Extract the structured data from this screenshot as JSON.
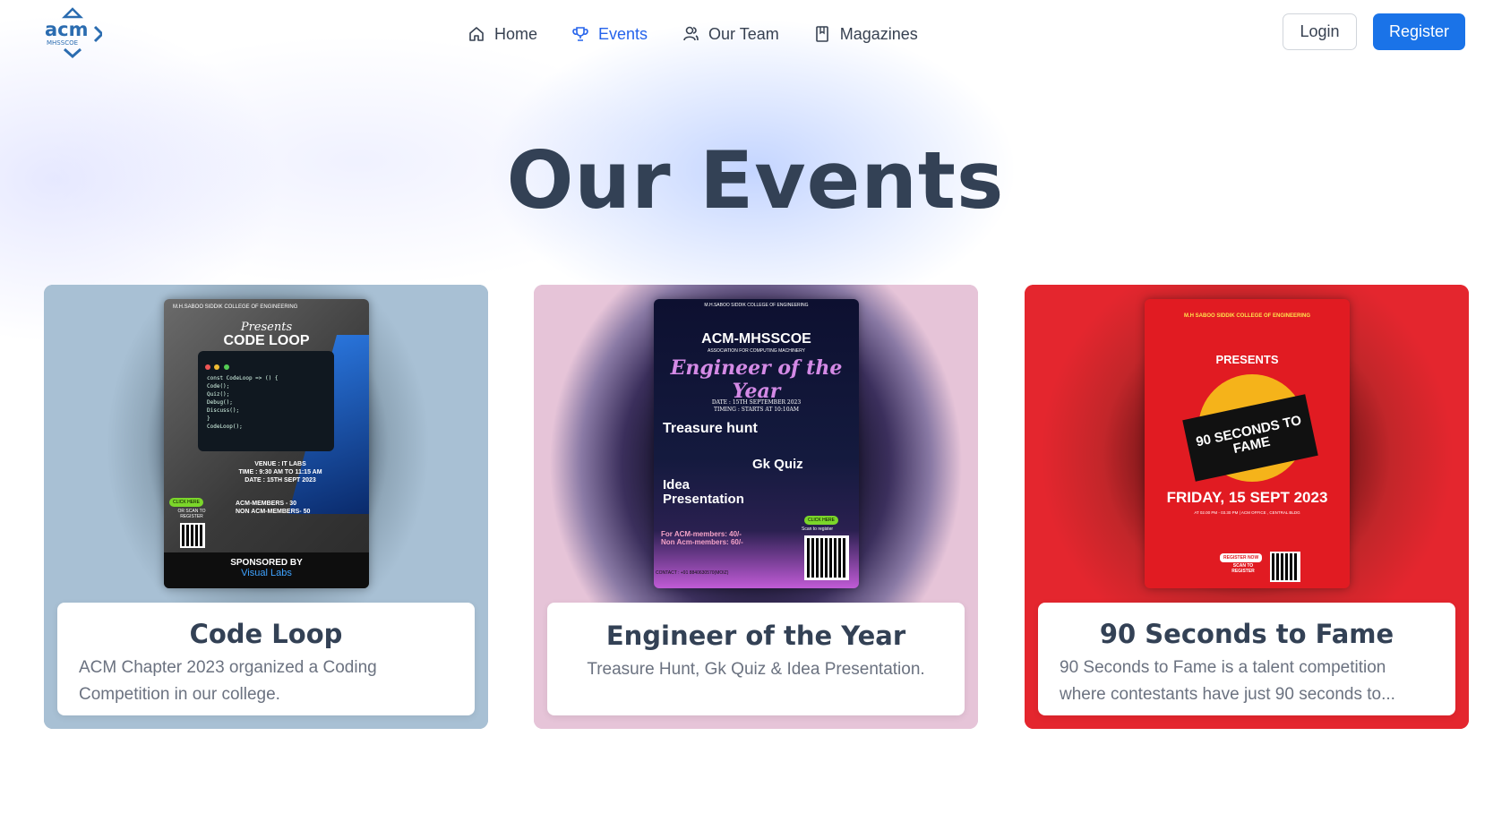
{
  "brand": {
    "logo_text": "acm",
    "logo_sub": "MHSSCOE",
    "accent": "#1a73e8"
  },
  "nav": {
    "items": [
      {
        "label": "Home",
        "icon": "home-icon",
        "active": false
      },
      {
        "label": "Events",
        "icon": "trophy-icon",
        "active": true
      },
      {
        "label": "Our Team",
        "icon": "team-icon",
        "active": false
      },
      {
        "label": "Magazines",
        "icon": "book-icon",
        "active": false
      }
    ],
    "login_label": "Login",
    "register_label": "Register"
  },
  "page": {
    "title": "Our Events"
  },
  "events": [
    {
      "title": "Code Loop",
      "description": "ACM Chapter 2023 organized a Coding Competition in our college.",
      "poster": {
        "college": "M.H.SABOO SIDDIK COLLEGE OF ENGINEERING",
        "presents": "Presents",
        "name": "CODE LOOP",
        "code": [
          "const CodeLoop => () {",
          "Code();",
          "Quiz();",
          "Debug();",
          "Discuss();",
          "}",
          "CodeLoop();"
        ],
        "venue": "VENUE : IT LABS",
        "time": "TIME : 9:30 AM TO 11:15 AM",
        "date": "DATE : 15TH SEPT 2023",
        "fee_members": "ACM-MEMBERS - 30",
        "fee_non": "NON ACM-MEMBERS- 50",
        "click": "CLICK HERE",
        "scan": "OR SCAN TO REGISTER",
        "sponsored": "SPONSORED BY",
        "sponsor": "Visual Labs"
      }
    },
    {
      "title": "Engineer of the Year",
      "description": "Treasure Hunt, Gk Quiz & Idea Presentation.",
      "poster": {
        "college": "M.H.SABOO SIDDIK COLLEGE OF ENGINEERING",
        "org": "ACM-MHSSCOE",
        "org_sub": "ASSOCIATION FOR COMPUTING MACHINERY",
        "name": "Engineer of the Year",
        "date": "DATE : 15TH SEPTEMBER 2023",
        "timing": "TIMING : STARTS AT 10:10AM",
        "item1": "Treasure hunt",
        "item2": "Gk Quiz",
        "item3": "Idea Presentation",
        "fee1": "For ACM-members: 40/-",
        "fee2": "Non Acm-members: 60/-",
        "click": "CLICK HERE",
        "scan": "Scan to register",
        "contact": "CONTACT : +91 8840630570(MOIZ)"
      }
    },
    {
      "title": "90 Seconds to Fame",
      "description": "90 Seconds to Fame is a talent competition where contestants have just 90 seconds to...",
      "poster": {
        "college": "M.H SABOO SIDDIK COLLEGE OF ENGINEERING",
        "presents": "PRESENTS",
        "name": "90 SECONDS TO FAME",
        "date": "FRIDAY, 15 SEPT 2023",
        "time": "AT 02.00 PM - 03.30 PM | ACM OFFICE , CENTRAL BLDG",
        "register": "REGISTER NOW",
        "scan": "SCAN TO REGISTER"
      }
    }
  ]
}
